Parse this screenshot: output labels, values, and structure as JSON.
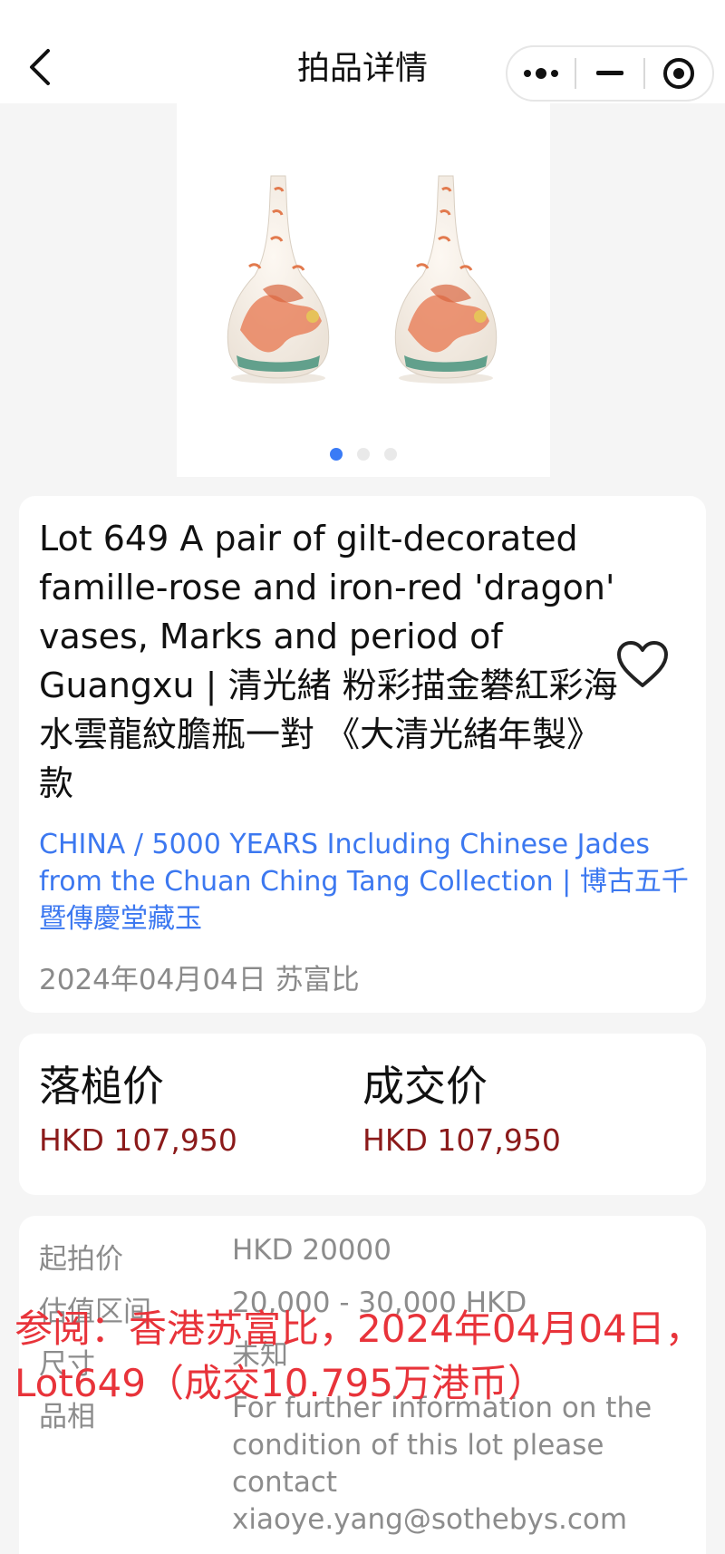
{
  "nav": {
    "title": "拍品详情"
  },
  "gallery": {
    "slide_count": 3,
    "active_index": 0
  },
  "lot": {
    "title": "Lot 649 A pair of gilt-decorated famille-rose and iron-red 'dragon' vases, Marks and period of Guangxu | 清光緒 粉彩描金礬紅彩海水雲龍紋膽瓶一對 《大清光緒年製》款",
    "sale": "CHINA / 5000 YEARS Including Chinese Jades from the Chuan Ching Tang Collection | 博古五千 暨傳慶堂藏玉",
    "date_house": "2024年04月04日 苏富比"
  },
  "prices": {
    "hammer_label": "落槌价",
    "hammer_value": "HKD 107,950",
    "deal_label": "成交价",
    "deal_value": "HKD 107,950"
  },
  "details": {
    "start_label": "起拍价",
    "start_value": "HKD 20000",
    "estimate_label": "估值区间",
    "estimate_value": "20,000 - 30,000 HKD",
    "size_label": "尺寸",
    "size_value": "未知",
    "condition_label": "品相",
    "condition_value": "For further information on the condition of this lot please contact xiaoye.yang@sothebys.com"
  },
  "overlay": {
    "text": "参阅：香港苏富比，2024年04月04日，Lot649（成交10.795万港币）"
  },
  "colors": {
    "accent": "#3a7bf6",
    "link": "#3c78f0",
    "price": "#8b1a1a",
    "overlay": "#e8333a"
  }
}
